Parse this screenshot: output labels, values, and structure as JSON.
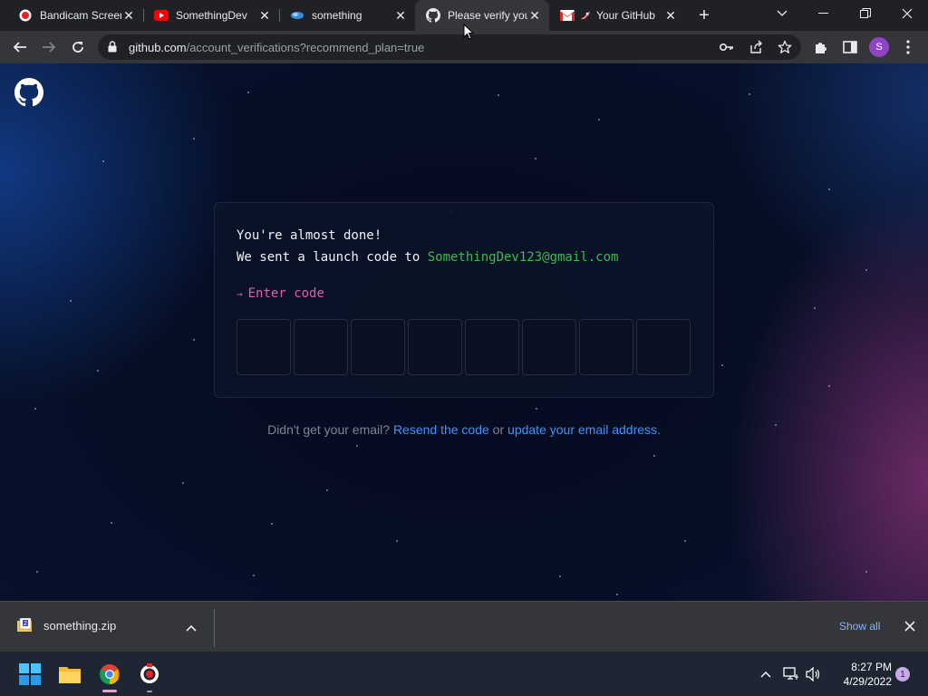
{
  "browser": {
    "tabs": [
      {
        "title": "Bandicam Screen",
        "icon": "bandicam-icon",
        "active": false
      },
      {
        "title": "SomethingDev",
        "icon": "youtube-icon",
        "active": false
      },
      {
        "title": "something",
        "icon": "site-icon",
        "active": false
      },
      {
        "title": "Please verify your",
        "icon": "github-icon",
        "active": true
      },
      {
        "title": "Your GitHub",
        "icon": "gmail-icon",
        "active": false
      }
    ],
    "url_host": "github.com",
    "url_path": "/account_verifications?recommend_plan=true",
    "profile_initial": "S"
  },
  "page": {
    "heading": "You're almost done!",
    "sent_text": "We sent a launch code to ",
    "email": "SomethingDev123@gmail.com",
    "prompt_arrow": "→",
    "prompt_label": "Enter code",
    "code_boxes": 8,
    "footer_prefix": "Didn't get your email? ",
    "resend_link": "Resend the code",
    "footer_or": " or ",
    "update_link": "update your email address",
    "footer_suffix": "."
  },
  "downloads": {
    "file_name": "something.zip",
    "show_all": "Show all"
  },
  "taskbar": {
    "time": "8:27 PM",
    "date": "4/29/2022",
    "notification_count": "1"
  },
  "colors": {
    "accent_green": "#3fb950",
    "prompt_pink": "#db61a2",
    "link_blue": "#4493f8"
  }
}
